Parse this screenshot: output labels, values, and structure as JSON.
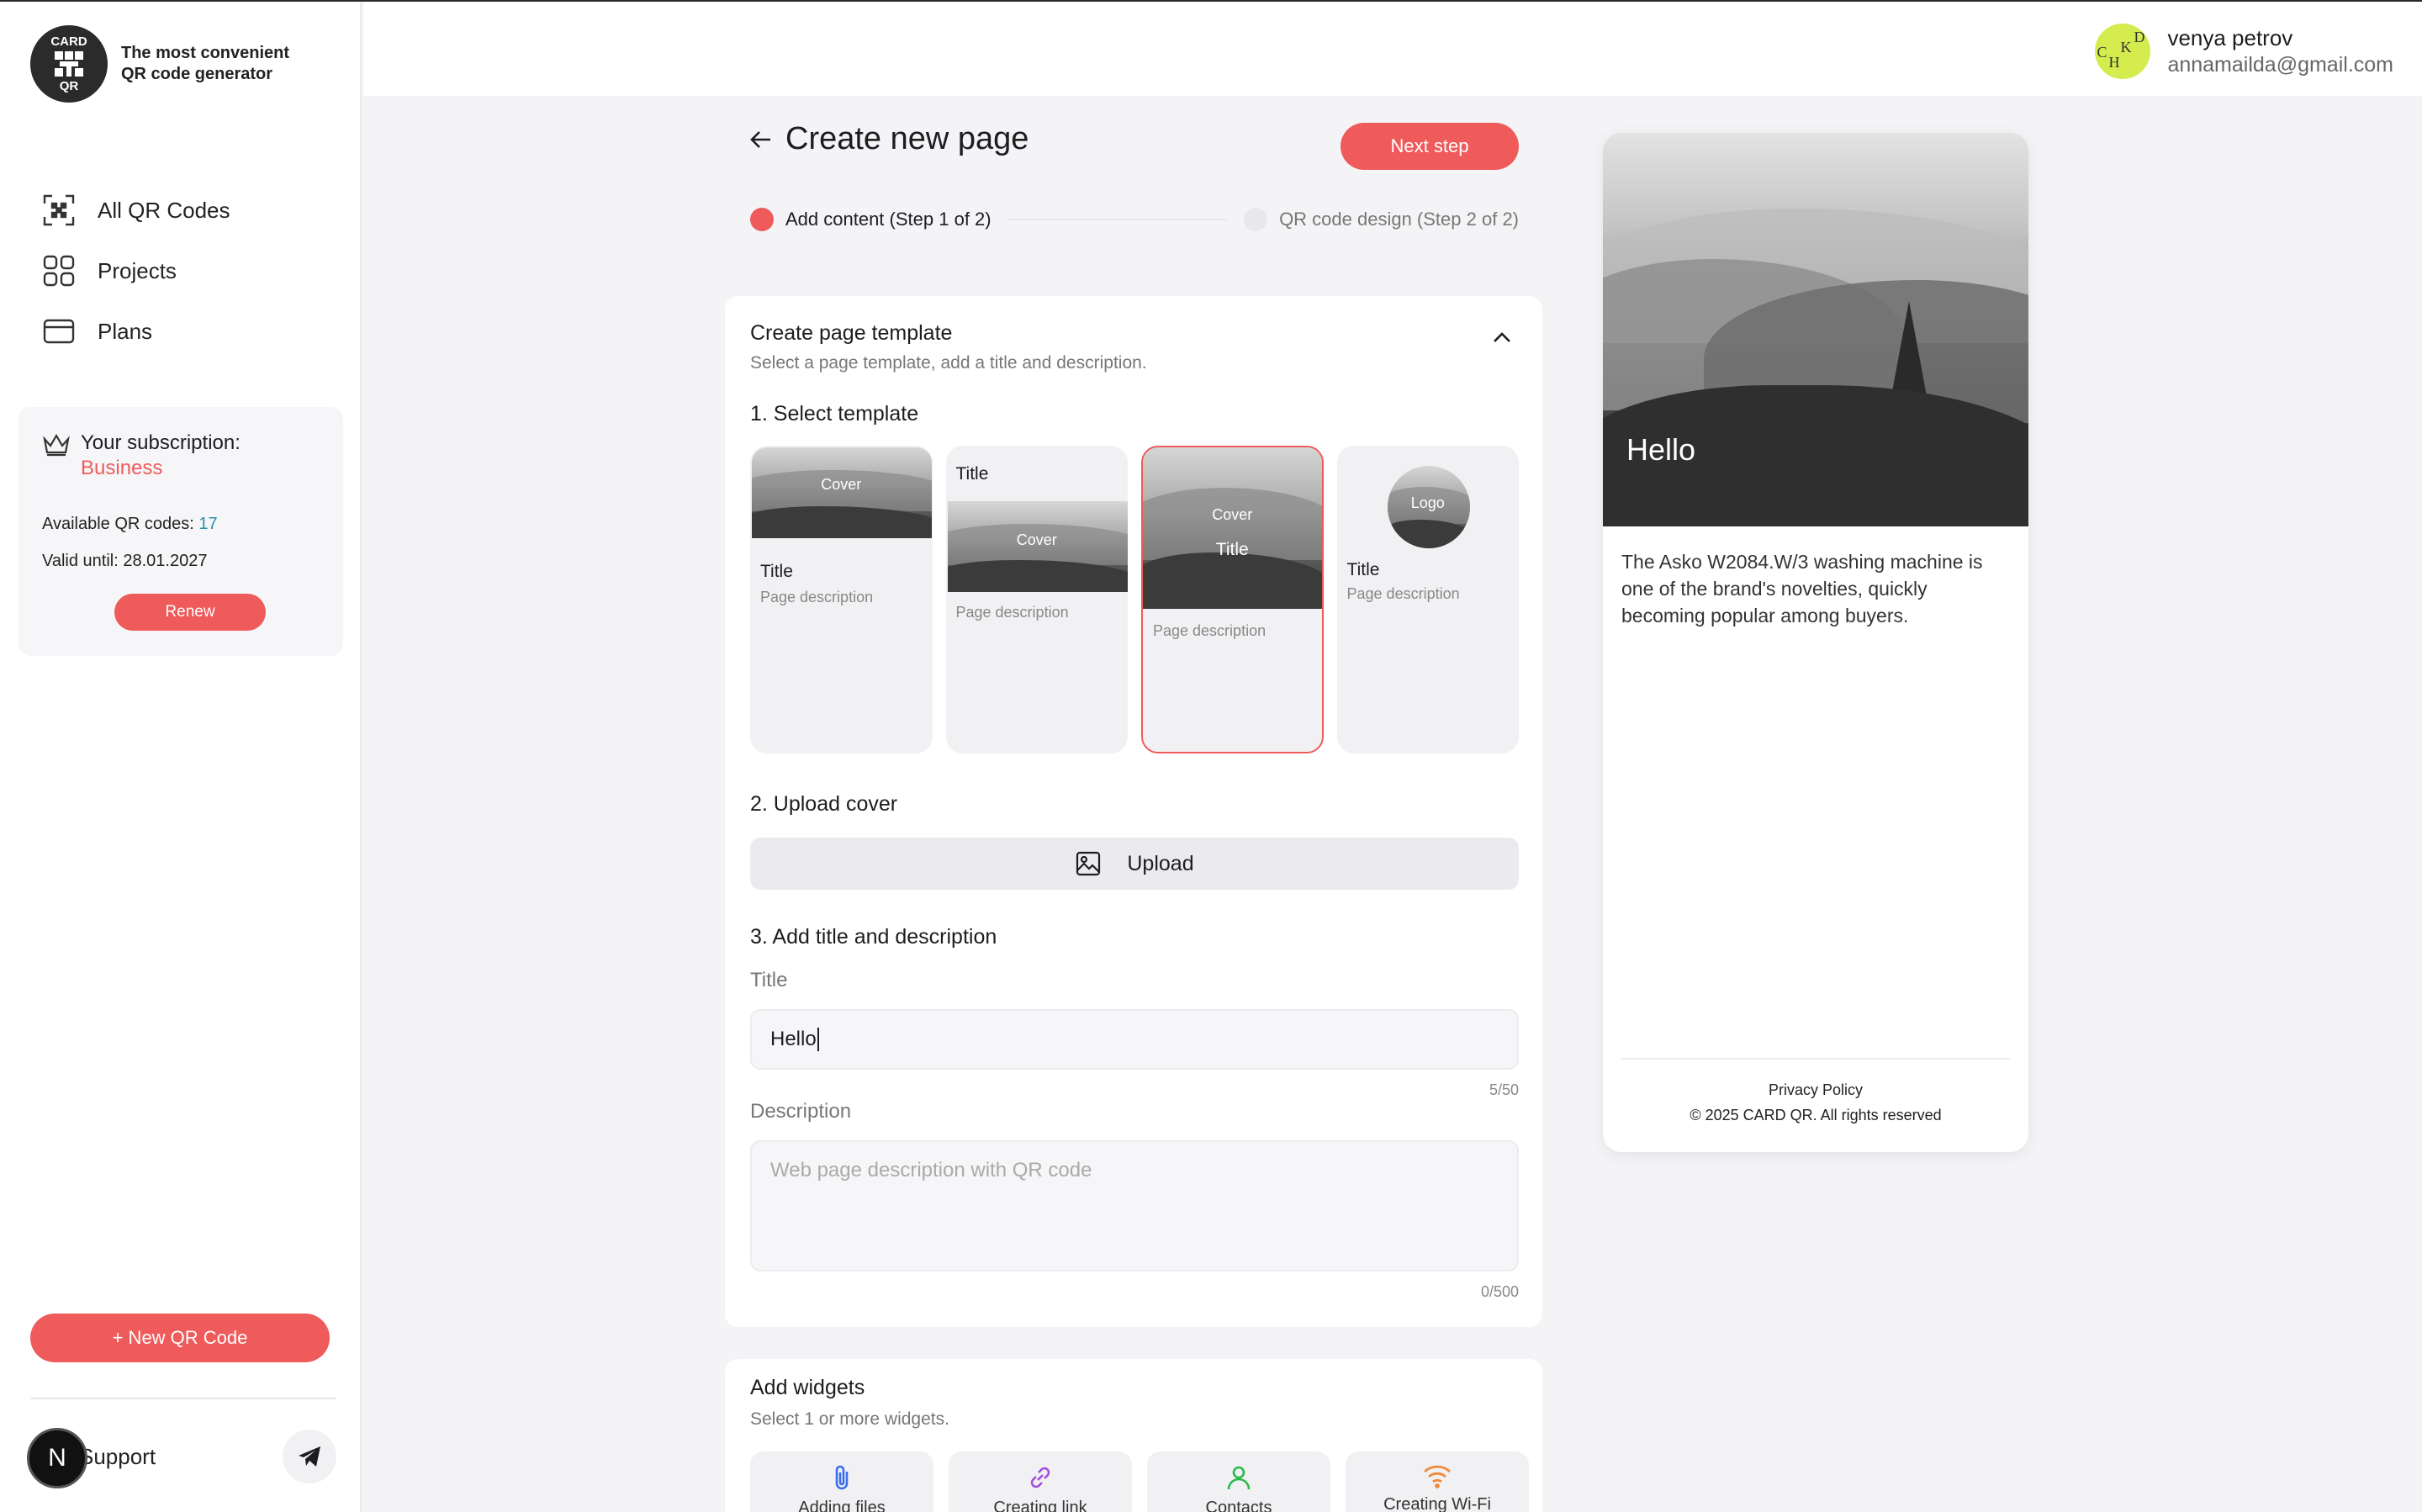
{
  "brand": {
    "logo_top": "CARD",
    "logo_bottom": "QR",
    "tagline": "The most convenient QR code generator"
  },
  "sidebar": {
    "items": [
      {
        "label": "All QR Codes",
        "icon": "qr-scan-icon"
      },
      {
        "label": "Projects",
        "icon": "grid-icon"
      },
      {
        "label": "Plans",
        "icon": "card-icon"
      }
    ],
    "subscription": {
      "heading": "Your subscription:",
      "plan": "Business",
      "available_label": "Available QR codes:",
      "available_value": "17",
      "valid_until": "Valid until: 28.01.2027",
      "renew_label": "Renew"
    },
    "new_qr_label": "+ New QR Code",
    "support_label": "Support",
    "badge_letter": "N"
  },
  "header": {
    "user_name": "venya petrov",
    "user_email": "annamailda@gmail.com",
    "avatar_letters": [
      "C",
      "H",
      "K",
      "D"
    ]
  },
  "page": {
    "title": "Create new page",
    "next_label": "Next step",
    "steps": [
      {
        "label": "Add content (Step 1 of 2)",
        "active": true
      },
      {
        "label": "QR code design (Step 2 of 2)",
        "active": false
      }
    ]
  },
  "template_panel": {
    "title": "Create page template",
    "subtitle": "Select a page template, add a title and description.",
    "section1": "1. Select template",
    "templates": [
      {
        "cover": "Cover",
        "title": "Title",
        "desc": "Page description"
      },
      {
        "cover": "Cover",
        "title": "Title",
        "desc": "Page description"
      },
      {
        "cover": "Cover",
        "title": "Title",
        "desc": "Page description"
      },
      {
        "cover": "Logo",
        "title": "Title",
        "desc": "Page description"
      }
    ],
    "section2": "2. Upload cover",
    "upload_label": "Upload",
    "section3": "3. Add title and description",
    "title_label": "Title",
    "title_value": "Hello",
    "title_counter": "5/50",
    "desc_label": "Description",
    "desc_placeholder": "Web page description with QR code",
    "desc_counter": "0/500"
  },
  "widgets_panel": {
    "title": "Add widgets",
    "subtitle": "Select 1 or more widgets.",
    "items": [
      {
        "label": "Adding files",
        "icon": "paperclip-icon",
        "color": "#3a6ee8"
      },
      {
        "label": "Creating link",
        "icon": "link-icon",
        "color": "#a24de0"
      },
      {
        "label": "Contacts",
        "icon": "contact-icon",
        "color": "#2bb94a"
      },
      {
        "label": "Creating Wi-Fi",
        "icon": "wifi-icon",
        "color": "#f08a3a"
      }
    ]
  },
  "preview": {
    "title": "Hello",
    "description": "The Asko W2084.W/3 washing machine is one of the brand's novelties, quickly becoming popular among buyers.",
    "privacy": "Privacy Policy",
    "copyright": "© 2025 CARD QR. All rights reserved"
  },
  "colors": {
    "accent": "#ef5a5a",
    "avatar": "#d4ec4e",
    "available_value": "#2a8fa8"
  }
}
